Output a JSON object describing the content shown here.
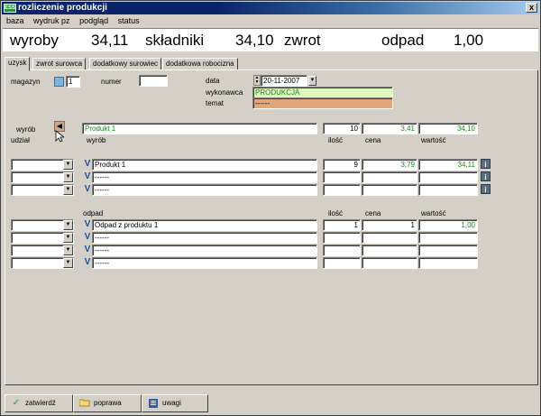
{
  "window": {
    "title": "rozliczenie produkcji",
    "app_icon": "ESS",
    "close_label": "x"
  },
  "menu": [
    "baza",
    "wydruk pz",
    "podgląd",
    "status"
  ],
  "summary": {
    "wyroby_label": "wyroby",
    "wyroby_value": "34,11",
    "skladniki_label": "składniki",
    "skladniki_value": "34,10",
    "zwrot_label": "zwrot",
    "odpad_label": "odpad",
    "odpad_value": "1,00"
  },
  "tabs": [
    "uzysk",
    "zwrot surowca",
    "dodatkowy surowiec",
    "dodatkowa robocizna"
  ],
  "header": {
    "magazyn_label": "magazyn",
    "magazyn_value": "1",
    "numer_label": "numer",
    "numer_value": "",
    "data_label": "data",
    "data_value": "20-11-2007",
    "wykonawca_label": "wykonawca",
    "wykonawca_value": "PRODUKCJA",
    "temat_label": "temat",
    "temat_value": "------"
  },
  "product": {
    "wyrob_label": "wyrób",
    "udzial_label": "udział",
    "wyrob_col_label": "wyrób",
    "name": "Produkt 1",
    "ilosc_label": "ilość",
    "cena_label": "cena",
    "wartosc_label": "wartość",
    "ilosc": "10",
    "cena": "3,41",
    "wartosc": "34,10"
  },
  "products_rows": [
    {
      "name": "Produkt 1",
      "ilosc": "9",
      "cena": "3,79",
      "wartosc": "34,11"
    },
    {
      "name": "------",
      "ilosc": "",
      "cena": "",
      "wartosc": ""
    },
    {
      "name": "------",
      "ilosc": "",
      "cena": "",
      "wartosc": ""
    }
  ],
  "odpad": {
    "odpad_label": "odpad",
    "ilosc_label": "ilość",
    "cena_label": "cena",
    "wartosc_label": "wartość",
    "rows": [
      {
        "name": "Odpad z produktu 1",
        "ilosc": "1",
        "cena": "1",
        "wartosc": "1,00"
      },
      {
        "name": "------",
        "ilosc": "",
        "cena": "",
        "wartosc": ""
      },
      {
        "name": "------",
        "ilosc": "",
        "cena": "",
        "wartosc": ""
      },
      {
        "name": "------",
        "ilosc": "",
        "cena": "",
        "wartosc": ""
      }
    ]
  },
  "buttons": {
    "zatwierdz": "zatwierdź",
    "poprawa": "poprawa",
    "uwagi": "uwagi"
  },
  "colors": {
    "title_bar": "#0a246a",
    "value_green": "#1a8a1a",
    "wykonawca_bg": "#dff8c0",
    "temat_bg": "#e3a67a"
  },
  "icons": [
    "check-icon",
    "folder-icon",
    "notes-icon",
    "info-icon",
    "dropdown-arrow-icon",
    "calendar-spin-icon",
    "pointer-cursor-icon"
  ]
}
